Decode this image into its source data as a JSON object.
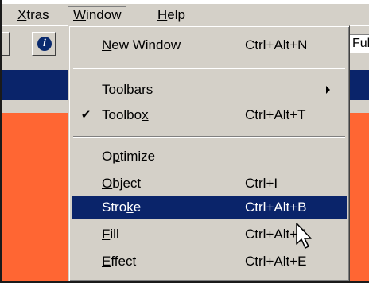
{
  "menubar": {
    "items": [
      {
        "label_pre": "",
        "label_u": "X",
        "label_post": "tras"
      },
      {
        "label_pre": "",
        "label_u": "W",
        "label_post": "indow"
      },
      {
        "label_pre": "",
        "label_u": "H",
        "label_post": "elp"
      }
    ]
  },
  "toolbar": {
    "info_glyph": "i",
    "field_value": "Ful"
  },
  "menu": {
    "items": [
      {
        "pre": "",
        "u": "N",
        "post": "ew Window",
        "shortcut": "Ctrl+Alt+N"
      },
      {
        "pre": "Toolb",
        "u": "a",
        "post": "rs",
        "shortcut": ""
      },
      {
        "pre": "Toolbo",
        "u": "x",
        "post": "",
        "shortcut": "Ctrl+Alt+T",
        "checked": "✔"
      },
      {
        "pre": "O",
        "u": "p",
        "post": "timize",
        "shortcut": ""
      },
      {
        "pre": "",
        "u": "O",
        "post": "bject",
        "shortcut": "Ctrl+I"
      },
      {
        "pre": "Stro",
        "u": "k",
        "post": "e",
        "shortcut": "Ctrl+Alt+B"
      },
      {
        "pre": "",
        "u": "F",
        "post": "ill",
        "shortcut": "Ctrl+Alt+F"
      },
      {
        "pre": "",
        "u": "E",
        "post": "ffect",
        "shortcut": "Ctrl+Alt+E"
      }
    ]
  },
  "colors": {
    "chrome": "#d4d0c8",
    "highlight": "#0a246a",
    "canvas": "#ff6633"
  },
  "icons": {
    "check": "check-icon",
    "submenu": "submenu-arrow-icon",
    "cursor": "cursor-icon",
    "info": "info-icon"
  }
}
